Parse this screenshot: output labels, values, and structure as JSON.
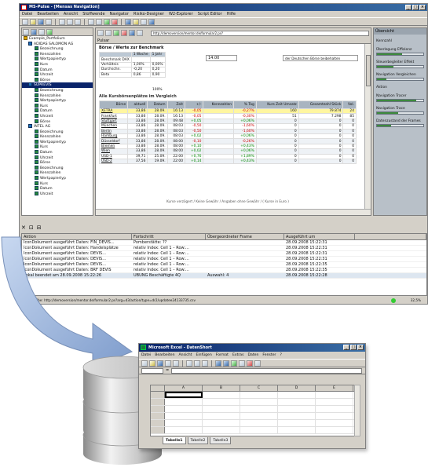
{
  "main_window": {
    "title": "MS-Pulse - [Mensas Navigation]",
    "menu": [
      "Datei",
      "Bearbeiten",
      "Ansicht",
      "Stoffwende",
      "Navigator",
      "Risiko-Designer",
      "W2-Explorer",
      "Script Editor",
      "Hilfe"
    ],
    "address": "http://demoversion/mentor.de/formular2.ps?",
    "tab_label": "Pulsar"
  },
  "tree": {
    "items": [
      {
        "label": "Example_Portfolium",
        "kind": "root"
      },
      {
        "label": "ADIDAS SALOMON AG",
        "kind": "grp"
      },
      {
        "label": "Bezeichnung",
        "kind": "leaf"
      },
      {
        "label": "Kennzahlen",
        "kind": "leaf"
      },
      {
        "label": "Wertpapiertyp",
        "kind": "leaf"
      },
      {
        "label": "Kurs",
        "kind": "leaf"
      },
      {
        "label": "Datum",
        "kind": "leaf"
      },
      {
        "label": "Uhrzeit",
        "kind": "leaf"
      },
      {
        "label": "Börse",
        "kind": "leaf"
      },
      {
        "label": "SUPREVIS",
        "kind": "grp"
      },
      {
        "label": "Bezeichnung",
        "kind": "leaf"
      },
      {
        "label": "Kennzahlen",
        "kind": "leaf"
      },
      {
        "label": "Wertpapiertyp",
        "kind": "leaf"
      },
      {
        "label": "Kurs",
        "kind": "leaf"
      },
      {
        "label": "Datum",
        "kind": "leaf"
      },
      {
        "label": "Uhrzeit",
        "kind": "leaf"
      },
      {
        "label": "Börse",
        "kind": "leaf"
      },
      {
        "label": "INTEL AG",
        "kind": "grp"
      },
      {
        "label": "Bezeichnung",
        "kind": "leaf"
      },
      {
        "label": "Kennzahlen",
        "kind": "leaf"
      },
      {
        "label": "Wertpapiertyp",
        "kind": "leaf"
      },
      {
        "label": "Kurs",
        "kind": "leaf"
      },
      {
        "label": "Datum",
        "kind": "leaf"
      },
      {
        "label": "Uhrzeit",
        "kind": "leaf"
      },
      {
        "label": "Börse",
        "kind": "leaf"
      },
      {
        "label": "Bezeichnung",
        "kind": "leaf"
      },
      {
        "label": "Kennzahlen",
        "kind": "leaf"
      },
      {
        "label": "Wertpapiertyp",
        "kind": "leaf"
      },
      {
        "label": "Kurs",
        "kind": "leaf"
      },
      {
        "label": "Datum",
        "kind": "leaf"
      },
      {
        "label": "Uhrzeit",
        "kind": "leaf"
      }
    ],
    "selected_index": 9
  },
  "summary": {
    "heading": "Börse / Werte zur Benchmark",
    "value_box": "14.00",
    "note": "der Deutschen Börse beibehalten",
    "headers": [
      "",
      "1 Woche",
      "1 Jahr"
    ],
    "rows": [
      [
        "Benchmark DAX",
        "",
        ""
      ],
      [
        "Verhältnis",
        "1,00%",
        "0,00%"
      ],
      [
        "Durchschn.",
        "-0,20",
        "0,20"
      ],
      [
        "Beta",
        "0,86",
        "0,90"
      ]
    ],
    "footer": "100%"
  },
  "comparison": {
    "title": "Alle Kursbörsenplätze im Vergleich",
    "headers": [
      "Börse",
      "aktuell",
      "Datum",
      "Zeit",
      "+/-",
      "Kennzahlen",
      "% Tag",
      "Kurs Zeit Umsatz",
      "Gesamtzahl Stück",
      "Vol."
    ],
    "rows": [
      {
        "cells": [
          "XETRA",
          "33,86",
          "28.09.",
          "16:13",
          "-0,05",
          "",
          "-0,27%",
          "160",
          "79.874",
          "24"
        ],
        "style": "hl"
      },
      {
        "cells": [
          "Frankfurt",
          "33,86",
          "28.09.",
          "16:13",
          "-0,05",
          "",
          "-0,30%",
          "51",
          "7.298",
          "85"
        ],
        "style": ""
      },
      {
        "cells": [
          "Stuttgart",
          "33,86",
          "28.09.",
          "09:48",
          "+0,05",
          "",
          "+0,06%",
          "0",
          "0",
          "0"
        ],
        "style": "alt"
      },
      {
        "cells": [
          "München",
          "33,86",
          "28.09.",
          "08:03",
          "-0,50",
          "",
          "-1,60%",
          "0",
          "0",
          "0"
        ],
        "style": ""
      },
      {
        "cells": [
          "Berlin",
          "33,86",
          "28.09.",
          "08:03",
          "-0,50",
          "",
          "-1,60%",
          "0",
          "0",
          "0"
        ],
        "style": "alt"
      },
      {
        "cells": [
          "Hamburg",
          "33,86",
          "28.09.",
          "08:03",
          "+0,02",
          "",
          "+0,06%",
          "0",
          "0",
          "0"
        ],
        "style": ""
      },
      {
        "cells": [
          "Düsseldorf",
          "33,86",
          "28.09.",
          "08:00",
          "-0,10",
          "",
          "-0,26%",
          "0",
          "0",
          "0"
        ],
        "style": "alt"
      },
      {
        "cells": [
          "Bremen",
          "33,86",
          "28.09.",
          "08:00",
          "+0,10",
          "",
          "+0,43%",
          "0",
          "0",
          "0"
        ],
        "style": ""
      },
      {
        "cells": [
          "Wien",
          "33,86",
          "28.09.",
          "08:00",
          "+0,02",
          "",
          "+0,06%",
          "0",
          "0",
          "0"
        ],
        "style": "alt"
      },
      {
        "cells": [
          "USD-1",
          "39,71",
          "25.09.",
          "22:00",
          "+0,76",
          "",
          "+1,89%",
          "0",
          "0",
          "0"
        ],
        "style": ""
      },
      {
        "cells": [
          "USD-2",
          "37,56",
          "19.09.",
          "22:00",
          "+0,14",
          "",
          "+0,43%",
          "0",
          "0",
          "0"
        ],
        "style": "alt"
      }
    ],
    "footer": "Kurse verzögert / Keine Gewähr / Angaben ohne Gewähr  /  ( Kurse in Euro )"
  },
  "right_panel": {
    "header": "Übersicht",
    "top_label": "Kennzahl",
    "bars": [
      {
        "label": "Überlegung Effizienz",
        "level": 0.55
      },
      {
        "label": "Steuerbegleiter Effekt",
        "level": 0.35
      },
      {
        "label": "Navigation Vergleichen",
        "level": 0.2
      },
      {
        "label": "Navigation Tracer",
        "level": 0.85
      },
      {
        "label": "Navigation Trace",
        "level": 0.45
      },
      {
        "label": "Datenzustand der Frames",
        "level": 0.3
      }
    ],
    "mid_label": "Aktion",
    "accent": "#3d8a3d"
  },
  "log": {
    "tools": [
      "✕",
      "⊡",
      "⊟"
    ],
    "headers": [
      "Aktion",
      "Fortschritt",
      "Übergeordneter Frame",
      "Ausgeführt um"
    ],
    "rows": [
      [
        "IconDokument ausgeführt Daten: FIN_DEVIS...",
        "Pomberstätte: ??",
        "",
        "28.09.2008 15:22:31"
      ],
      [
        "IconDokument ausgeführt Daten: Handelsplätze",
        "relativ Index: Cell 1 – Row:...",
        "",
        "28.09.2008 15:22:31"
      ],
      [
        "IconDokument ausgeführt Daten: DEVIS...",
        "relativ Index: Cell 1 – Row:...",
        "",
        "28.09.2008 15:22:31"
      ],
      [
        "IconDokument ausgeführt Daten: DEVIS...",
        "relativ Index: Cell 1 – Row:...",
        "",
        "28.09.2008 15:22:31"
      ],
      [
        "IconDokument ausgeführt Daten: DEVIS...",
        "relativ Index: Cell 1 – Row:...",
        "",
        "28.09.2008 15:22:35"
      ],
      [
        "IconDokument ausgeführt Daten: BRF DEVIS",
        "relativ Index: Cell 1 – Row:...",
        "",
        "28.09.2008 15:22:35"
      ],
      [
        "Lokal beendet am 28.09.2008 15:22:26",
        "ÜBUNG Beschäftigte 4Q",
        "Auswahl: 4",
        "28.09.2008 15:22:28"
      ]
    ],
    "status": "Startlaufbe: http://demoversion/mentor.de/formular2.ps?arg=d3/action/type=dr2/updatee24133735.csv",
    "zoom": "32,5%"
  },
  "excel": {
    "title": "Microsoft Excel - DatenShort",
    "menu": [
      "Datei",
      "Bearbeiten",
      "Ansicht",
      "Einfügen",
      "Format",
      "Extras",
      "Daten",
      "Fenster",
      "?"
    ],
    "columns": [
      "A",
      "B",
      "C",
      "D",
      "E"
    ],
    "sheets": [
      "Tabelle1",
      "Tabelle2",
      "Tabelle3"
    ]
  }
}
